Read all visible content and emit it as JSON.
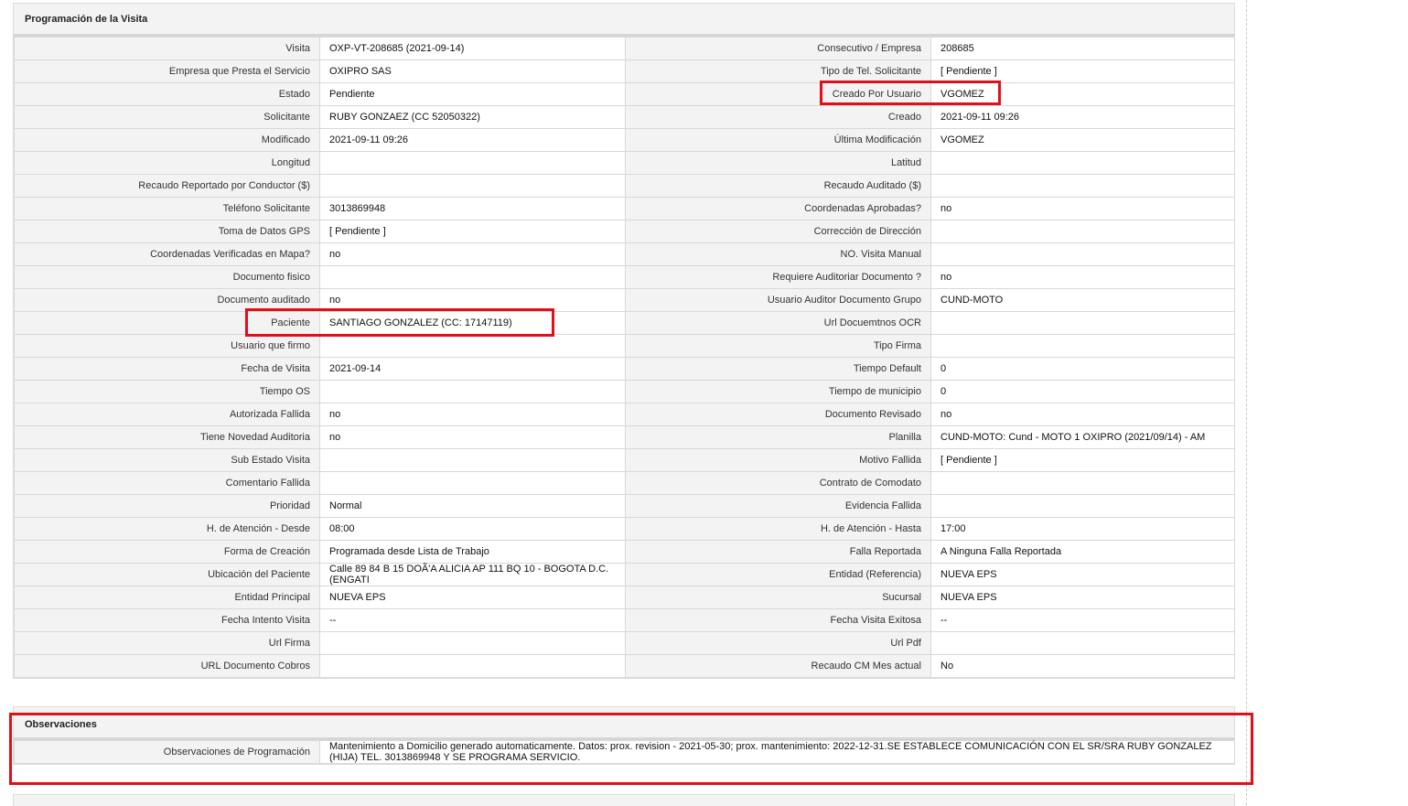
{
  "section_title": "Programación de la Visita",
  "rows": [
    {
      "l1": "Visita",
      "v1": "OXP-VT-208685 (2021-09-14)",
      "l2": "Consecutivo / Empresa",
      "v2": "208685"
    },
    {
      "l1": "Empresa que Presta el Servicio",
      "v1": "OXIPRO SAS",
      "l2": "Tipo de Tel. Solicitante",
      "v2": "[ Pendiente ]"
    },
    {
      "l1": "Estado",
      "v1": "Pendiente",
      "l2": "Creado Por Usuario",
      "v2": "VGOMEZ"
    },
    {
      "l1": "Solicitante",
      "v1": "RUBY GONZAEZ (CC 52050322)",
      "l2": "Creado",
      "v2": "2021-09-11 09:26"
    },
    {
      "l1": "Modificado",
      "v1": "2021-09-11 09:26",
      "l2": "Última Modificación",
      "v2": " VGOMEZ"
    },
    {
      "l1": "Longitud",
      "v1": "",
      "l2": "Latitud",
      "v2": ""
    },
    {
      "l1": "Recaudo Reportado por Conductor ($)",
      "v1": "",
      "l2": "Recaudo Auditado ($)",
      "v2": ""
    },
    {
      "l1": "Teléfono Solicitante",
      "v1": "3013869948",
      "l2": "Coordenadas Aprobadas?",
      "v2": " no"
    },
    {
      "l1": "Toma de Datos GPS",
      "v1": "[ Pendiente ]",
      "l2": "Corrección de Dirección",
      "v2": ""
    },
    {
      "l1": "Coordenadas Verificadas en Mapa?",
      "v1": " no",
      "l2": "NO. Visita Manual",
      "v2": ""
    },
    {
      "l1": "Documento fisico",
      "v1": "",
      "l2": "Requiere Auditoriar Documento ?",
      "v2": " no"
    },
    {
      "l1": "Documento auditado",
      "v1": " no",
      "l2": "Usuario Auditor Documento Grupo",
      "v2": "CUND-MOTO"
    },
    {
      "l1": "Paciente",
      "v1": "SANTIAGO GONZALEZ (CC: 17147119)",
      "l2": "Url Docuemtnos OCR",
      "v2": ""
    },
    {
      "l1": "Usuario que firmo",
      "v1": "",
      "l2": "Tipo Firma",
      "v2": ""
    },
    {
      "l1": "Fecha de Visita",
      "v1": " 2021-09-14",
      "l2": "Tiempo Default",
      "v2": "0"
    },
    {
      "l1": "Tiempo OS",
      "v1": "",
      "l2": "Tiempo de municipio",
      "v2": "0"
    },
    {
      "l1": "Autorizada Fallida",
      "v1": " no",
      "l2": "Documento Revisado",
      "v2": " no"
    },
    {
      "l1": "Tiene Novedad Auditoria",
      "v1": " no",
      "l2": "Planilla",
      "v2": "CUND-MOTO: Cund - MOTO 1 OXIPRO (2021/09/14) - AM"
    },
    {
      "l1": "Sub Estado Visita",
      "v1": "",
      "l2": "Motivo Fallida",
      "v2": "[ Pendiente ]"
    },
    {
      "l1": "Comentario Fallida",
      "v1": "",
      "l2": "Contrato de Comodato",
      "v2": ""
    },
    {
      "l1": "Prioridad",
      "v1": "Normal",
      "l2": "Evidencia Fallida",
      "v2": ""
    },
    {
      "l1": "H. de Atención - Desde",
      "v1": "08:00",
      "l2": "H. de Atención - Hasta",
      "v2": "17:00"
    },
    {
      "l1": "Forma de Creación",
      "v1": "Programada desde Lista de Trabajo",
      "l2": "Falla Reportada",
      "v2": "A Ninguna Falla Reportada"
    },
    {
      "l1": "Ubicación del Paciente",
      "v1": "Calle 89 84 B 15 DOÃ'A ALICIA AP 111 BQ 10 - BOGOTA D.C. (ENGATI",
      "l2": "Entidad (Referencia)",
      "v2": "NUEVA EPS"
    },
    {
      "l1": "Entidad Principal",
      "v1": "NUEVA EPS",
      "l2": "Sucursal",
      "v2": "NUEVA EPS"
    },
    {
      "l1": "Fecha Intento Visita",
      "v1": " --",
      "l2": "Fecha Visita Exitosa",
      "v2": " --"
    },
    {
      "l1": "Url Firma",
      "v1": "",
      "l2": "Url Pdf",
      "v2": ""
    },
    {
      "l1": "URL Documento Cobros",
      "v1": "",
      "l2": "Recaudo CM Mes actual",
      "v2": " No"
    }
  ],
  "observaciones": {
    "title": "Observaciones",
    "label": "Observaciones de Programación",
    "value": "   Mantenimiento a Domicilio generado automaticamente. Datos: prox. revision - 2021-05-30; prox. mantenimiento: 2022-12-31.SE ESTABLECE COMUNICACIÓN CON EL SR/SRA RUBY GONZALEZ (HIJA) TEL. 3013869948 Y SE PROGRAMA SERVICIO."
  },
  "colors": {
    "highlight": "#e0101a",
    "panel": "#f3f3f3",
    "border": "#d8d8d8"
  }
}
